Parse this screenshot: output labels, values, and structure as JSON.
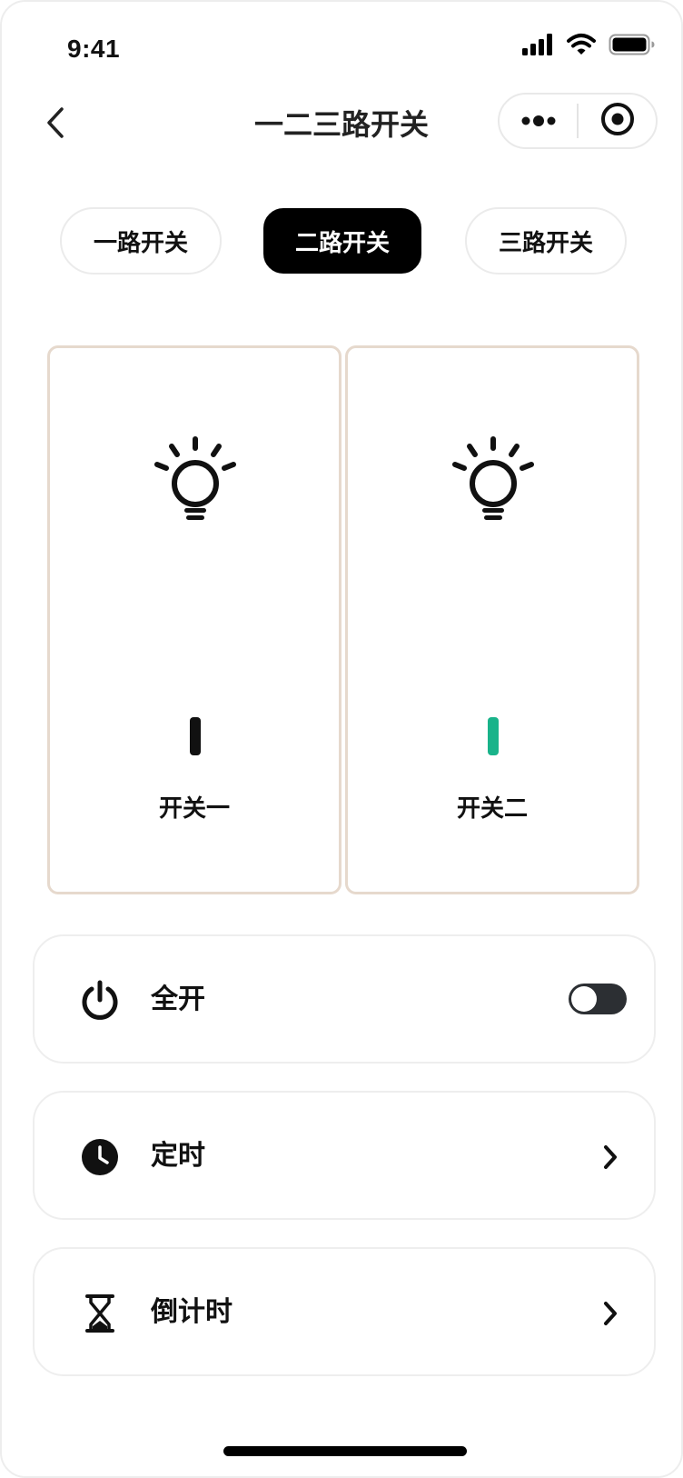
{
  "status_bar": {
    "time": "9:41",
    "icons": [
      "signal-icon",
      "wifi-icon",
      "battery-icon"
    ]
  },
  "nav": {
    "title": "一二三路开关",
    "back_icon": "chevron-left-icon",
    "more_icon": "more-dots-icon",
    "close_icon": "target-circle-icon"
  },
  "tabs": [
    {
      "label": "一路开关",
      "active": false
    },
    {
      "label": "二路开关",
      "active": true
    },
    {
      "label": "三路开关",
      "active": false
    }
  ],
  "switches": [
    {
      "label": "开关一",
      "icon": "light-bulb-icon",
      "indicator_color": "#111111"
    },
    {
      "label": "开关二",
      "icon": "light-bulb-icon",
      "indicator_color": "#19b38a"
    }
  ],
  "rows": {
    "all_on": {
      "label": "全开",
      "icon": "power-icon",
      "toggle_on": false
    },
    "schedule": {
      "label": "定时",
      "icon": "clock-icon"
    },
    "countdown": {
      "label": "倒计时",
      "icon": "hourglass-icon"
    }
  },
  "colors": {
    "card_border": "#e6d9cd",
    "active_tab_bg": "#000000",
    "switch_one_indicator": "#111111",
    "switch_two_indicator": "#19b38a",
    "toggle_track": "#2c2f33"
  }
}
